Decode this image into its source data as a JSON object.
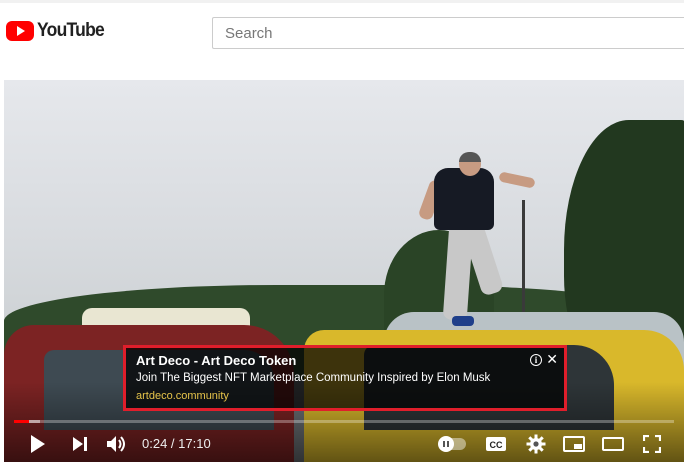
{
  "header": {
    "logo_text": "YouTube",
    "search_placeholder": "Search"
  },
  "ad": {
    "title": "Art Deco - Art Deco Token",
    "description": "Join The Biggest NFT Marketplace Community Inspired by Elon Musk",
    "url": "artdeco.community",
    "info_glyph": "i",
    "close_glyph": "✕",
    "highlight_color": "#e01e2b"
  },
  "player": {
    "time_display": "0:24 / 17:10",
    "progress_fraction": 0.023,
    "buffered_fraction": 0.04,
    "accent_color": "#ff0000",
    "icons": [
      "play-icon",
      "next-icon",
      "volume-icon",
      "autoplay-toggle",
      "captions-icon",
      "settings-icon",
      "miniplayer-icon",
      "theater-icon",
      "fullscreen-icon"
    ]
  }
}
